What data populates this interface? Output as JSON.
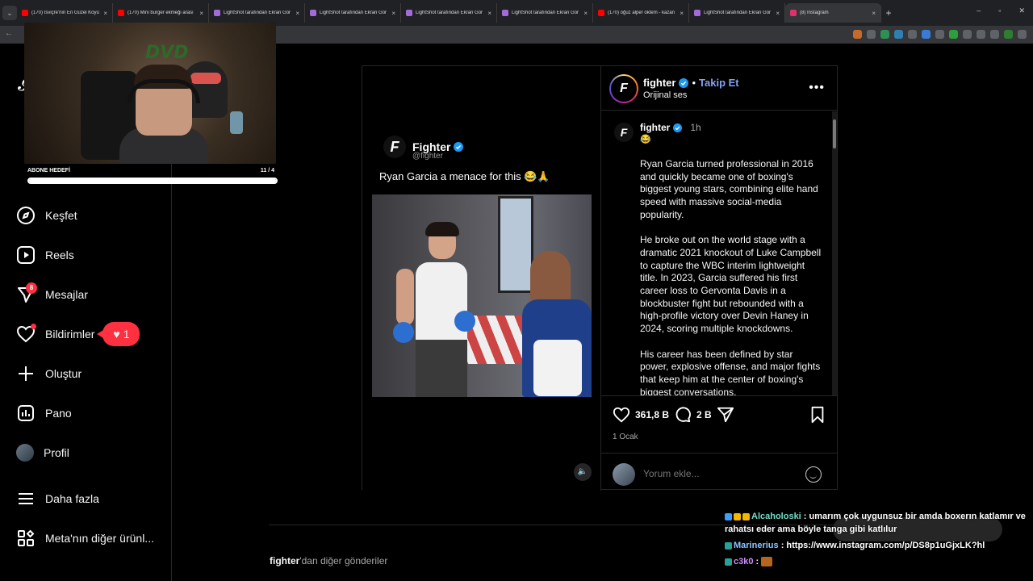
{
  "browser": {
    "tabs": [
      {
        "label": "(170) İsviçre'nin En Güzel Köyü",
        "color": "#ff0000"
      },
      {
        "label": "(170) Mini burger ekmeği arası",
        "color": "#ff0000"
      },
      {
        "label": "LightShot tarafından Ekran Gör",
        "color": "#a46bd8"
      },
      {
        "label": "LightShot tarafından Ekran Gör",
        "color": "#a46bd8"
      },
      {
        "label": "LightShot tarafından Ekran Gör",
        "color": "#a46bd8"
      },
      {
        "label": "LightShot tarafından Ekran Gör",
        "color": "#a46bd8"
      },
      {
        "label": "(170) oğuz alper öktem - kazan",
        "color": "#ff0000"
      },
      {
        "label": "LightShot tarafından Ekran Gör",
        "color": "#a46bd8"
      },
      {
        "label": "(8) Instagram",
        "color": "#e1306c",
        "active": true
      }
    ],
    "new_tab": "+",
    "close": "×"
  },
  "stream": {
    "cam_logo": "DVD",
    "goal_title": "ABONE HEDEFİ",
    "goal_count": "11 / 4",
    "goal_fill": 1.0
  },
  "sidebar": {
    "items": [
      {
        "key": "kesfet",
        "label": "Keşfet"
      },
      {
        "key": "reels",
        "label": "Reels"
      },
      {
        "key": "mesajlar",
        "label": "Mesajlar",
        "badge": "8"
      },
      {
        "key": "bildirimler",
        "label": "Bildirimler",
        "pill_count": "1"
      },
      {
        "key": "olustur",
        "label": "Oluştur"
      },
      {
        "key": "pano",
        "label": "Pano"
      },
      {
        "key": "profil",
        "label": "Profil"
      },
      {
        "key": "daha",
        "label": "Daha fazla"
      },
      {
        "key": "meta",
        "label": "Meta'nın diğer ürünl..."
      }
    ]
  },
  "post": {
    "media": {
      "tweet_name": "Fighter",
      "tweet_handle": "@fighter",
      "tweet_text": "Ryan Garcia a menace for this 😂🙏"
    },
    "header": {
      "username": "fighter",
      "follow": "Takip Et",
      "separator": "•",
      "audio": "Orijinal ses",
      "more": "•••"
    },
    "caption": {
      "username": "fighter",
      "time": "1h",
      "emoji": "😂",
      "paragraphs": [
        "Ryan Garcia turned professional in 2016 and quickly became one of boxing's biggest young stars, combining elite hand speed with massive social-media popularity.",
        "He broke out on the world stage with a dramatic 2021 knockout of Luke Campbell to capture the WBC interim lightweight title. In 2023, Garcia suffered his first career loss to Gervonta Davis in a blockbuster fight but rebounded with a high-profile victory over Devin Haney in 2024, scoring multiple knockdowns.",
        "His career has been defined by star power, explosive offense, and major fights that keep him at the center of boxing's biggest conversations."
      ]
    },
    "likes": "361,8 B",
    "comments": "2 B",
    "date": "1 Ocak",
    "comment_placeholder": "Yorum ekle..."
  },
  "more_posts": {
    "username": "fighter",
    "suffix": "'dan diğer gönderiler"
  },
  "chat": [
    {
      "user": "Alcaholoski",
      "text": "umarım çok uygunsuz bir amda boxerın katlamır ve rahatsı eder ama böyle tanga gibi katlılur"
    },
    {
      "user": "Marinerius",
      "text": "https://www.instagram.com/p/DS8p1uGjxLK?hl"
    },
    {
      "user": "c3k0",
      "text": ""
    }
  ]
}
